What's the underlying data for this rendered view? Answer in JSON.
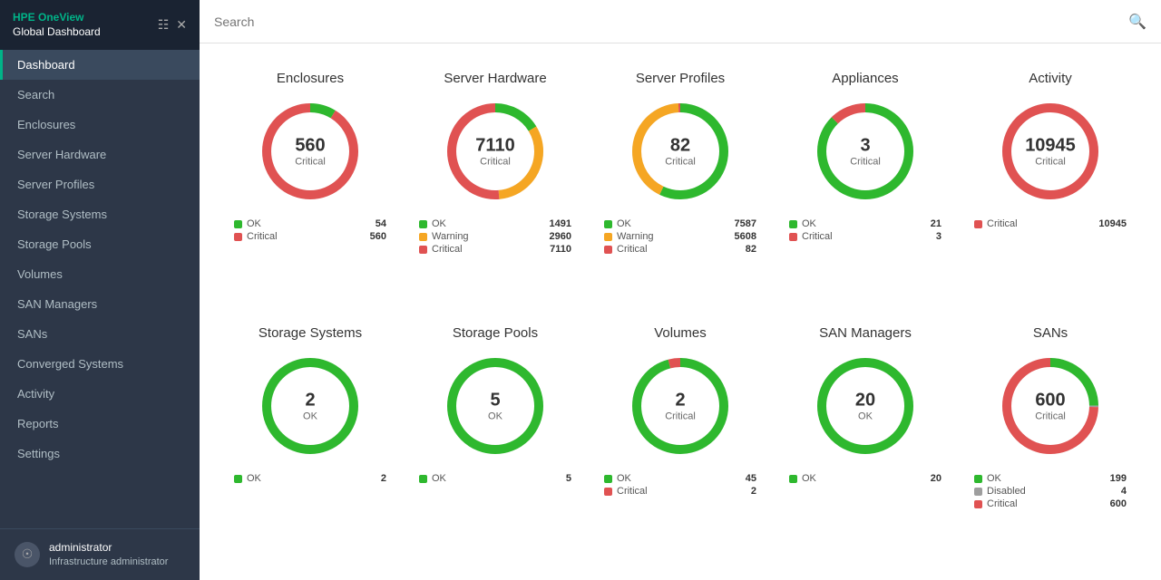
{
  "sidebar": {
    "logo_line1": "HPE OneView",
    "logo_line2": "Global Dashboard",
    "items": [
      {
        "label": "Dashboard",
        "active": true
      },
      {
        "label": "Search",
        "active": false
      },
      {
        "label": "Enclosures",
        "active": false
      },
      {
        "label": "Server Hardware",
        "active": false
      },
      {
        "label": "Server Profiles",
        "active": false
      },
      {
        "label": "Storage Systems",
        "active": false
      },
      {
        "label": "Storage Pools",
        "active": false
      },
      {
        "label": "Volumes",
        "active": false
      },
      {
        "label": "SAN Managers",
        "active": false
      },
      {
        "label": "SANs",
        "active": false
      },
      {
        "label": "Converged Systems",
        "active": false
      },
      {
        "label": "Activity",
        "active": false
      },
      {
        "label": "Reports",
        "active": false
      },
      {
        "label": "Settings",
        "active": false
      }
    ],
    "user_name": "administrator",
    "user_role": "Infrastructure administrator"
  },
  "topbar": {
    "search_placeholder": "Search"
  },
  "cards": [
    {
      "title": "Enclosures",
      "value": "560",
      "status": "Critical",
      "segments": [
        {
          "color": "#2eb82e",
          "pct": 8.79
        },
        {
          "color": "#e05252",
          "pct": 91.21
        }
      ],
      "legend": [
        {
          "color": "ok",
          "label": "OK",
          "count": "54"
        },
        {
          "color": "critical",
          "label": "Critical",
          "count": "560"
        }
      ]
    },
    {
      "title": "Server Hardware",
      "value": "7110",
      "status": "Critical",
      "segments": [
        {
          "color": "#2eb82e",
          "pct": 16.28
        },
        {
          "color": "#f5a623",
          "pct": 32.28
        },
        {
          "color": "#e05252",
          "pct": 51.44
        }
      ],
      "legend": [
        {
          "color": "ok",
          "label": "OK",
          "count": "1491"
        },
        {
          "color": "warning",
          "label": "Warning",
          "count": "2960"
        },
        {
          "color": "critical",
          "label": "Critical",
          "count": "7110"
        }
      ]
    },
    {
      "title": "Server Profiles",
      "value": "82",
      "status": "Critical",
      "segments": [
        {
          "color": "#2eb82e",
          "pct": 57.02
        },
        {
          "color": "#f5a623",
          "pct": 42.17
        },
        {
          "color": "#e05252",
          "pct": 0.81
        }
      ],
      "legend": [
        {
          "color": "ok",
          "label": "OK",
          "count": "7587"
        },
        {
          "color": "warning",
          "label": "Warning",
          "count": "5608"
        },
        {
          "color": "critical",
          "label": "Critical",
          "count": "82"
        }
      ]
    },
    {
      "title": "Appliances",
      "value": "3",
      "status": "Critical",
      "segments": [
        {
          "color": "#2eb82e",
          "pct": 87.5
        },
        {
          "color": "#e05252",
          "pct": 12.5
        }
      ],
      "legend": [
        {
          "color": "ok",
          "label": "OK",
          "count": "21"
        },
        {
          "color": "critical",
          "label": "Critical",
          "count": "3"
        }
      ]
    },
    {
      "title": "Activity",
      "value": "10945",
      "status": "Critical",
      "segments": [
        {
          "color": "#e05252",
          "pct": 100
        }
      ],
      "legend": [
        {
          "color": "critical",
          "label": "Critical",
          "count": "10945"
        }
      ]
    },
    {
      "title": "Storage Systems",
      "value": "2",
      "status": "OK",
      "segments": [
        {
          "color": "#2eb82e",
          "pct": 100
        }
      ],
      "legend": [
        {
          "color": "ok",
          "label": "OK",
          "count": "2"
        }
      ]
    },
    {
      "title": "Storage Pools",
      "value": "5",
      "status": "OK",
      "segments": [
        {
          "color": "#2eb82e",
          "pct": 100
        }
      ],
      "legend": [
        {
          "color": "ok",
          "label": "OK",
          "count": "5"
        }
      ]
    },
    {
      "title": "Volumes",
      "value": "2",
      "status": "Critical",
      "segments": [
        {
          "color": "#2eb82e",
          "pct": 95.77
        },
        {
          "color": "#e05252",
          "pct": 4.23
        }
      ],
      "legend": [
        {
          "color": "ok",
          "label": "OK",
          "count": "45"
        },
        {
          "color": "critical",
          "label": "Critical",
          "count": "2"
        }
      ]
    },
    {
      "title": "SAN Managers",
      "value": "20",
      "status": "OK",
      "segments": [
        {
          "color": "#2eb82e",
          "pct": 100
        }
      ],
      "legend": [
        {
          "color": "ok",
          "label": "OK",
          "count": "20"
        }
      ]
    },
    {
      "title": "SANs",
      "value": "600",
      "status": "Critical",
      "segments": [
        {
          "color": "#2eb82e",
          "pct": 24.84
        },
        {
          "color": "#9e9e9e",
          "pct": 0.5
        },
        {
          "color": "#e05252",
          "pct": 74.66
        }
      ],
      "legend": [
        {
          "color": "ok",
          "label": "OK",
          "count": "199"
        },
        {
          "color": "disabled",
          "label": "Disabled",
          "count": "4"
        },
        {
          "color": "critical",
          "label": "Critical",
          "count": "600"
        }
      ]
    }
  ]
}
